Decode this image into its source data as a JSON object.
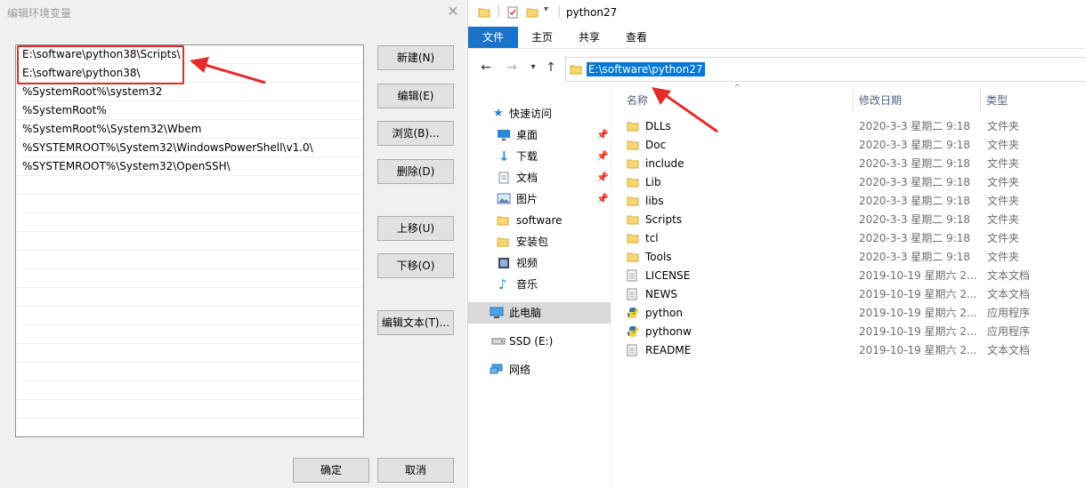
{
  "dialog": {
    "title": "编辑环境变量",
    "close_glyph": "✕",
    "paths": [
      "E:\\software\\python38\\Scripts\\",
      "E:\\software\\python38\\",
      "%SystemRoot%\\system32",
      "%SystemRoot%",
      "%SystemRoot%\\System32\\Wbem",
      "%SYSTEMROOT%\\System32\\WindowsPowerShell\\v1.0\\",
      "%SYSTEMROOT%\\System32\\OpenSSH\\"
    ],
    "buttons": {
      "new": "新建(N)",
      "edit": "编辑(E)",
      "browse": "浏览(B)...",
      "delete": "删除(D)",
      "move_up": "上移(U)",
      "move_down": "下移(O)",
      "edit_text": "编辑文本(T)...",
      "ok": "确定",
      "cancel": "取消"
    },
    "annotation_color": "#e52b2b"
  },
  "explorer": {
    "window_title": "python27",
    "ribbon_tabs": [
      "文件",
      "主页",
      "共享",
      "查看"
    ],
    "address": "E:\\software\\python27",
    "nav_icons": [
      "back-arrow-icon",
      "forward-arrow-icon",
      "recent-dropdown-icon",
      "up-arrow-icon"
    ],
    "nav_pane": [
      {
        "label": "快速访问",
        "icon": "star-icon",
        "pinned": false
      },
      {
        "label": "桌面",
        "icon": "desktop-icon",
        "pinned": true
      },
      {
        "label": "下载",
        "icon": "download-icon",
        "pinned": true
      },
      {
        "label": "文档",
        "icon": "document-icon",
        "pinned": true
      },
      {
        "label": "图片",
        "icon": "picture-icon",
        "pinned": true
      },
      {
        "label": "software",
        "icon": "folder-icon",
        "pinned": false
      },
      {
        "label": "安装包",
        "icon": "folder-icon",
        "pinned": false
      },
      {
        "label": "视频",
        "icon": "video-icon",
        "pinned": false
      },
      {
        "label": "音乐",
        "icon": "music-icon",
        "pinned": false
      },
      {
        "label": "此电脑",
        "icon": "pc-icon",
        "pinned": false
      },
      {
        "label": "SSD (E:)",
        "icon": "drive-icon",
        "pinned": false
      },
      {
        "label": "网络",
        "icon": "network-icon",
        "pinned": false
      }
    ],
    "columns": {
      "name": "名称",
      "modified": "修改日期",
      "type": "类型"
    },
    "files": [
      {
        "name": "DLLs",
        "date": "2020-3-3 星期二 9:18",
        "type": "文件夹",
        "kind": "folder"
      },
      {
        "name": "Doc",
        "date": "2020-3-3 星期二 9:18",
        "type": "文件夹",
        "kind": "folder"
      },
      {
        "name": "include",
        "date": "2020-3-3 星期二 9:18",
        "type": "文件夹",
        "kind": "folder"
      },
      {
        "name": "Lib",
        "date": "2020-3-3 星期二 9:18",
        "type": "文件夹",
        "kind": "folder"
      },
      {
        "name": "libs",
        "date": "2020-3-3 星期二 9:18",
        "type": "文件夹",
        "kind": "folder"
      },
      {
        "name": "Scripts",
        "date": "2020-3-3 星期二 9:18",
        "type": "文件夹",
        "kind": "folder"
      },
      {
        "name": "tcl",
        "date": "2020-3-3 星期二 9:18",
        "type": "文件夹",
        "kind": "folder"
      },
      {
        "name": "Tools",
        "date": "2020-3-3 星期二 9:18",
        "type": "文件夹",
        "kind": "folder"
      },
      {
        "name": "LICENSE",
        "date": "2019-10-19 星期六 2...",
        "type": "文本文档",
        "kind": "text"
      },
      {
        "name": "NEWS",
        "date": "2019-10-19 星期六 2...",
        "type": "文本文档",
        "kind": "text"
      },
      {
        "name": "python",
        "date": "2019-10-19 星期六 2...",
        "type": "应用程序",
        "kind": "app"
      },
      {
        "name": "pythonw",
        "date": "2019-10-19 星期六 2...",
        "type": "应用程序",
        "kind": "app"
      },
      {
        "name": "README",
        "date": "2019-10-19 星期六 2...",
        "type": "文本文档",
        "kind": "text"
      }
    ],
    "accent_color": "#1a73c9",
    "selection_color": "#0078d7"
  }
}
